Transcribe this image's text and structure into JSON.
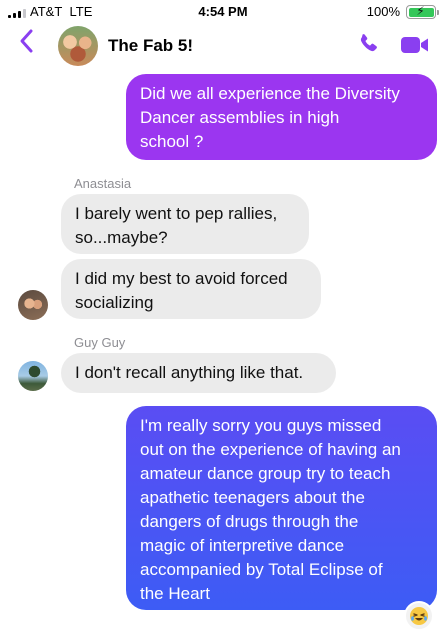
{
  "status_bar": {
    "carrier": "AT&T",
    "network": "LTE",
    "time": "4:54 PM",
    "battery_percent": "100%",
    "battery_level": 1.0,
    "battery_charging": true
  },
  "header": {
    "title": "The Fab 5!",
    "back_icon": "chevron-left-icon",
    "call_icon": "phone-icon",
    "video_icon": "video-camera-icon",
    "accent_color": "#8a3ff0"
  },
  "messages": [
    {
      "direction": "out",
      "text_lines": [
        "Did we all experience the Diversity",
        "Dancer assemblies in high",
        "school ?"
      ]
    },
    {
      "sender": "Anastasia"
    },
    {
      "direction": "in",
      "text_lines": [
        "I barely went to pep rallies,",
        "so...maybe?"
      ]
    },
    {
      "direction": "in",
      "text_lines": [
        "I did my best to avoid forced",
        "socializing"
      ]
    },
    {
      "sender": "Guy Guy"
    },
    {
      "direction": "in",
      "text_lines": [
        "I don't recall anything like that."
      ]
    },
    {
      "direction": "out",
      "text_lines": [
        "I'm really sorry you guys missed",
        "out on the experience of having an",
        "amateur dance group try to teach",
        "apathetic teenagers about the",
        "dangers of drugs through the",
        "magic of interpretive dance",
        "accompanied by Total Eclipse of",
        "the Heart"
      ],
      "reaction": "laughing-tears-emoji"
    }
  ],
  "colors": {
    "bubble_out_top": "#9b36f0",
    "bubble_out_bottom": "#3d5cf5",
    "bubble_in": "#ebebeb"
  }
}
